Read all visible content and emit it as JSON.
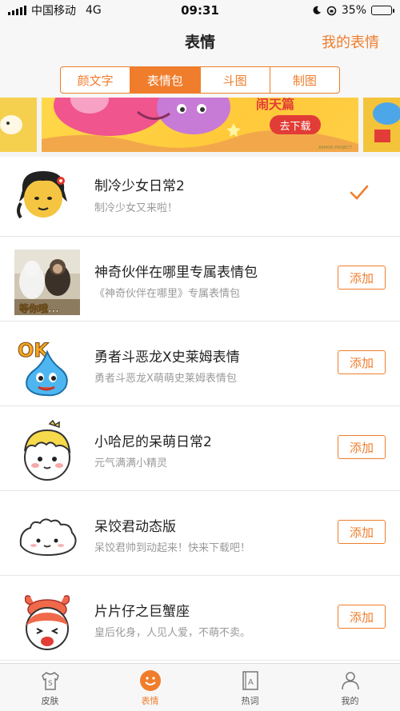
{
  "status_bar": {
    "carrier": "中国移动",
    "network": "4G",
    "time": "09:31",
    "battery": "35%",
    "battery_level": 0.35
  },
  "nav": {
    "title": "表情",
    "right_action": "我的表情"
  },
  "segments": [
    {
      "label": "颜文字",
      "active": false
    },
    {
      "label": "表情包",
      "active": true
    },
    {
      "label": "斗图",
      "active": false
    },
    {
      "label": "制图",
      "active": false
    }
  ],
  "banner": {
    "button_label": "去下载"
  },
  "packs": [
    {
      "title": "制冷少女日常2",
      "subtitle": "制冷少女又来啦！",
      "state": "added",
      "icon": "girl-face-icon"
    },
    {
      "title": "神奇伙伴在哪里专属表情包",
      "subtitle": "《神奇伙伴在哪里》专属表情包",
      "state": "add",
      "action_label": "添加",
      "icon": "monkey-photo-icon"
    },
    {
      "title": "勇者斗恶龙X史莱姆表情",
      "subtitle": "勇者斗恶龙X萌萌史莱姆表情包",
      "state": "add",
      "action_label": "添加",
      "icon": "slime-ok-icon"
    },
    {
      "title": "小哈尼的呆萌日常2",
      "subtitle": "元气满满小精灵",
      "state": "add",
      "action_label": "添加",
      "icon": "boy-face-icon"
    },
    {
      "title": "呆饺君动态版",
      "subtitle": "呆饺君帅到动起来！快来下载吧！",
      "state": "add",
      "action_label": "添加",
      "icon": "dumpling-icon"
    },
    {
      "title": "片片仔之巨蟹座",
      "subtitle": "皇后化身，人见人爱，不萌不卖。",
      "state": "add",
      "action_label": "添加",
      "icon": "crab-girl-icon"
    }
  ],
  "tabs": [
    {
      "label": "皮肤",
      "icon": "shirt-icon",
      "active": false
    },
    {
      "label": "表情",
      "icon": "smile-icon",
      "active": true
    },
    {
      "label": "热词",
      "icon": "book-icon",
      "active": false
    },
    {
      "label": "我的",
      "icon": "person-icon",
      "active": false
    }
  ],
  "colors": {
    "accent": "#ef7d2c",
    "background": "#f4f4f4"
  }
}
